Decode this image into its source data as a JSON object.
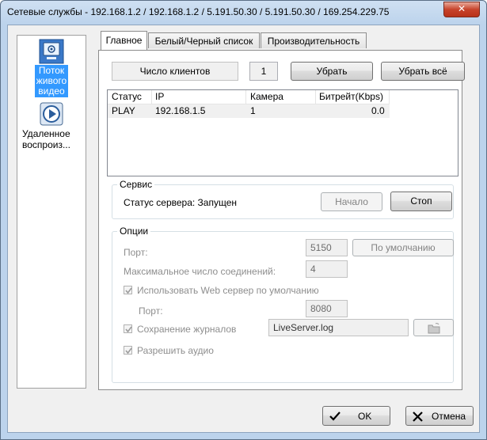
{
  "window": {
    "title": "Сетевые службы - 192.168.1.2 / 192.168.1.2 / 5.191.50.30 / 5.191.50.30 / 169.254.229.75",
    "close_label": "✕"
  },
  "nav": {
    "items": [
      {
        "label_lines": [
          "Поток",
          "живого",
          "видео"
        ],
        "icon": "live-stream-icon",
        "selected": true
      },
      {
        "label_lines": [
          "Удаленное",
          "воспроиз..."
        ],
        "icon": "playback-icon",
        "selected": false
      }
    ]
  },
  "tabs": [
    {
      "label": "Главное",
      "active": true
    },
    {
      "label": "Белый/Черный  список",
      "active": false
    },
    {
      "label": "Производительность",
      "active": false
    }
  ],
  "clients": {
    "count_label": "Число клиентов",
    "count_value": "1",
    "remove_label": "Убрать",
    "remove_all_label": "Убрать всё",
    "columns": [
      "Статус",
      "IP",
      "Камера",
      "Битрейт(Kbps)"
    ],
    "rows": [
      {
        "status": "PLAY",
        "ip": "192.168.1.5",
        "camera": "1",
        "bitrate": "0.0"
      }
    ]
  },
  "service": {
    "title": "Сервис",
    "status_text": "Статус сервера: Запущен",
    "start_label": "Начало",
    "stop_label": "Стоп"
  },
  "options": {
    "title": "Опции",
    "port_label": "Порт:",
    "port_value": "5150",
    "default_label": "По умолчанию",
    "max_conn_label": "Максимальное число соединений:",
    "max_conn_value": "4",
    "use_web_label": "Использовать Web сервер по умолчанию",
    "use_web_checked": true,
    "web_port_label": "Порт:",
    "web_port_value": "8080",
    "save_logs_label": "Сохранение журналов",
    "save_logs_checked": true,
    "log_file": "LiveServer.log",
    "allow_audio_label": "Разрешить аудио",
    "allow_audio_checked": true
  },
  "footer": {
    "ok_label": "OK",
    "cancel_label": "Отмена"
  },
  "colors": {
    "selection": "#3399ff",
    "title_bar": "#bcd3ec",
    "close_button": "#c7432b"
  }
}
